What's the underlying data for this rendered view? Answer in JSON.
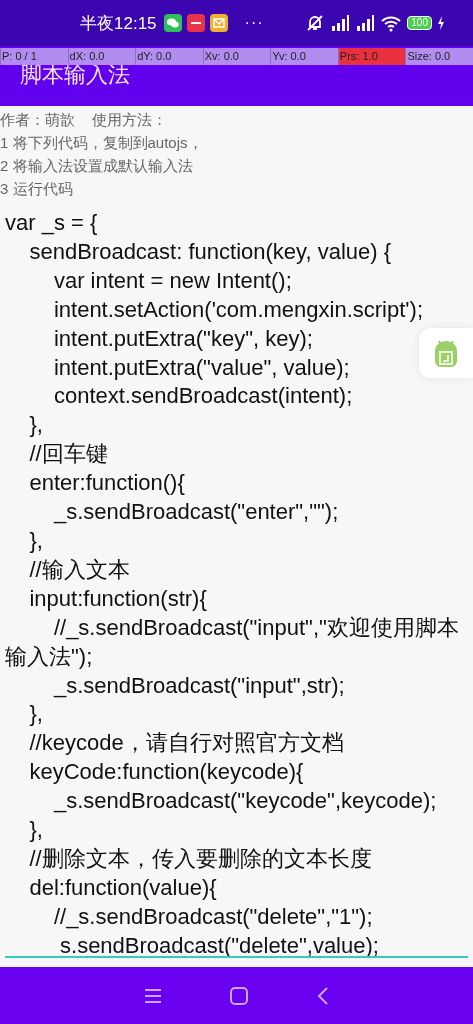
{
  "status_bar": {
    "time": "半夜12:15",
    "more": "···",
    "battery": "100"
  },
  "pointer_overlay": [
    {
      "text": "P: 0 / 1",
      "highlighted": false
    },
    {
      "text": "dX: 0.0",
      "highlighted": false
    },
    {
      "text": "dY: 0.0",
      "highlighted": false
    },
    {
      "text": "Xv: 0.0",
      "highlighted": false
    },
    {
      "text": "Yv: 0.0",
      "highlighted": false
    },
    {
      "text": "Prs: 1.0",
      "highlighted": true
    },
    {
      "text": "Size: 0.0",
      "highlighted": false
    }
  ],
  "app_bar": {
    "title": "脚本输入法"
  },
  "instructions": [
    "作者：萌歆    使用方法：",
    "1 将下列代码，复制到autojs，",
    "2 将输入法设置成默认输入法",
    "3 运行代码"
  ],
  "code": "var _s = {\n    sendBroadcast: function(key, value) {\n        var intent = new Intent();\n        intent.setAction('com.mengxin.script');\n        intent.putExtra(\"key\", key);\n        intent.putExtra(\"value\", value);\n        context.sendBroadcast(intent);\n    },\n    //回车键\n    enter:function(){\n        _s.sendBroadcast(\"enter\",\"\");\n    },\n    //输入文本\n    input:function(str){\n        //_s.sendBroadcast(\"input\",\"欢迎使用脚本输入法\");\n        _s.sendBroadcast(\"input\",str);\n    },\n    //keycode，请自行对照官方文档\n    keyCode:function(keycode){\n        _s.sendBroadcast(\"keycode\",keycode);\n    },\n    //删除文本，传入要删除的文本长度\n    del:function(value){\n        //_s.sendBroadcast(\"delete\",\"1\");\n         s.sendBroadcast(\"delete\",value);"
}
